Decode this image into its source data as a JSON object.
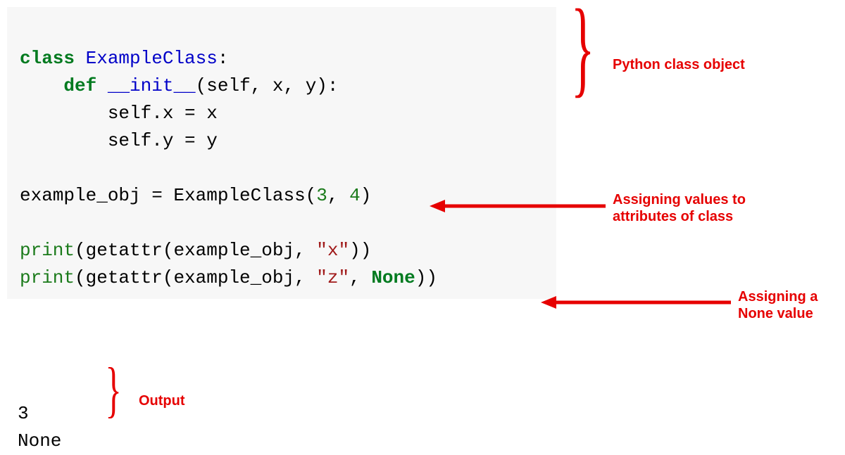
{
  "colors": {
    "annotation": "#e60000"
  },
  "code": {
    "kw_class": "class",
    "class_name": "ExampleClass",
    "colon": ":",
    "kw_def": "def",
    "init_name": "__init__",
    "def_sig_tail": "(self, x, y):",
    "body1": "self.x = x",
    "body2": "self.y = y",
    "obj_line_a": "example_obj = ExampleClass(",
    "num1": "3",
    "comma_sp": ", ",
    "num2": "4",
    "close_paren": ")",
    "print1_a": "print",
    "print1_b": "(getattr(example_obj, ",
    "str_x": "\"x\"",
    "print1_c": "))",
    "print2_a": "print",
    "print2_b": "(getattr(example_obj, ",
    "str_z": "\"z\"",
    "print2_c": ", ",
    "none_kw": "None",
    "print2_d": "))"
  },
  "output": {
    "line1": "3",
    "line2": "None"
  },
  "annotations": {
    "class_obj": "Python class object",
    "assign_vals_l1": "Assigning values to",
    "assign_vals_l2": "attributes of class",
    "assign_none_l1": "Assigning a",
    "assign_none_l2": "None value",
    "output_label": "Output"
  }
}
